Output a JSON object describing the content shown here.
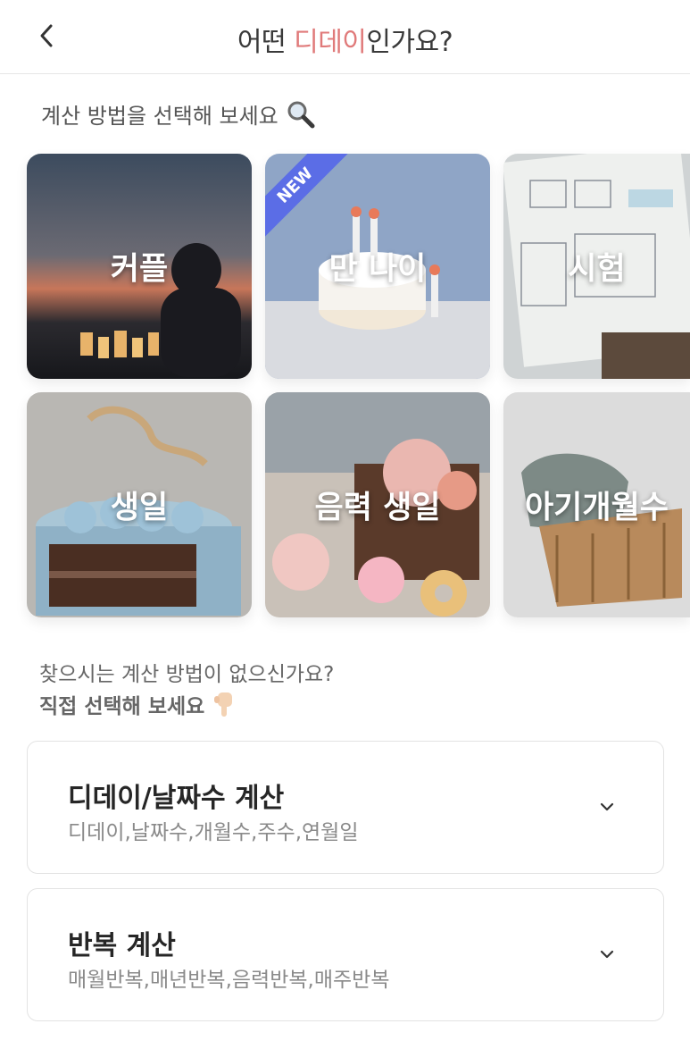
{
  "header": {
    "title_prefix": "어떤 ",
    "title_accent": "디데이",
    "title_suffix": "인가요?",
    "accent_color": "#e07a7a"
  },
  "subtitle": {
    "text": "계산 방법을 선택해 보세요",
    "icon": "magnifier-icon"
  },
  "cards": [
    {
      "label": "커플",
      "badge": ""
    },
    {
      "label": "만 나이",
      "badge": "NEW"
    },
    {
      "label": "시험",
      "badge": ""
    },
    {
      "label": "생일",
      "badge": ""
    },
    {
      "label": "음력 생일",
      "badge": ""
    },
    {
      "label": "아기개월수",
      "badge": ""
    }
  ],
  "hint": {
    "question": "찾으시는 계산 방법이 없으신가요?",
    "direct": "직접 선택해 보세요",
    "icon": "pointing-down-hand-icon"
  },
  "options": [
    {
      "title": "디데이/날짜수 계산",
      "subtitle": "디데이,날짜수,개월수,주수,연월일"
    },
    {
      "title": "반복 계산",
      "subtitle": "매월반복,매년반복,음력반복,매주반복"
    }
  ]
}
